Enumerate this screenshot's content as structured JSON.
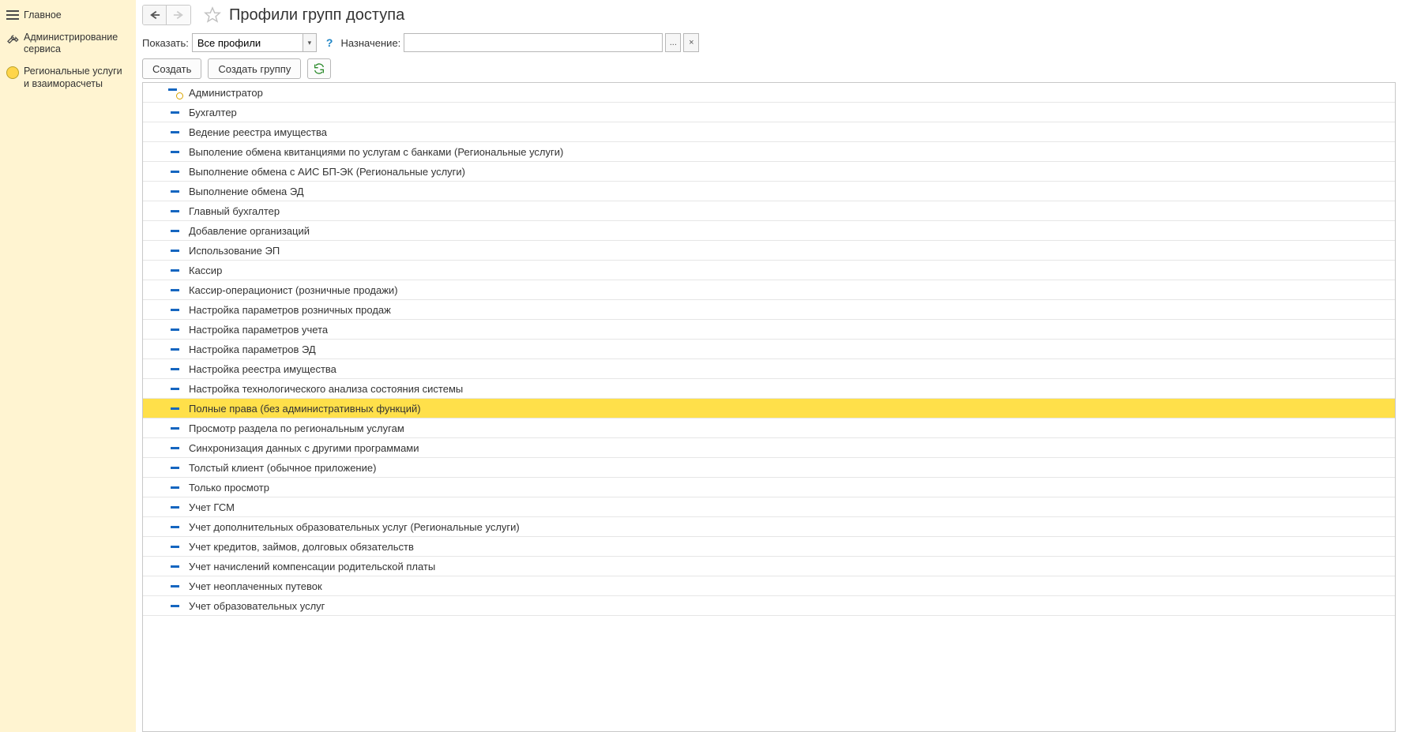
{
  "sidebar": {
    "items": [
      {
        "label": "Главное",
        "icon": "menu"
      },
      {
        "label": "Администрирование сервиса",
        "icon": "wrench"
      },
      {
        "label": "Региональные услуги и взаиморасчеты",
        "icon": "circle"
      }
    ]
  },
  "header": {
    "title": "Профили групп доступа"
  },
  "filter": {
    "show_label": "Показать:",
    "show_value": "Все профили",
    "destination_label": "Назначение:",
    "destination_value": "",
    "more_button": "...",
    "clear_button": "×"
  },
  "toolbar": {
    "create_label": "Создать",
    "create_group_label": "Создать группу"
  },
  "grid": {
    "rows": [
      {
        "label": "Администратор",
        "icon": "admin",
        "selected": false
      },
      {
        "label": "Бухгалтер",
        "icon": "dash",
        "selected": false
      },
      {
        "label": "Ведение реестра имущества",
        "icon": "dash",
        "selected": false
      },
      {
        "label": "Выполение обмена квитанциями по услугам с банками (Региональные услуги)",
        "icon": "dash",
        "selected": false
      },
      {
        "label": "Выполнение обмена с АИС БП-ЭК (Региональные услуги)",
        "icon": "dash",
        "selected": false
      },
      {
        "label": "Выполнение обмена ЭД",
        "icon": "dash",
        "selected": false
      },
      {
        "label": "Главный бухгалтер",
        "icon": "dash",
        "selected": false
      },
      {
        "label": "Добавление организаций",
        "icon": "dash",
        "selected": false
      },
      {
        "label": "Использование ЭП",
        "icon": "dash",
        "selected": false
      },
      {
        "label": "Кассир",
        "icon": "dash",
        "selected": false
      },
      {
        "label": "Кассир-операционист (розничные продажи)",
        "icon": "dash",
        "selected": false
      },
      {
        "label": "Настройка параметров розничных продаж",
        "icon": "dash",
        "selected": false
      },
      {
        "label": "Настройка параметров учета",
        "icon": "dash",
        "selected": false
      },
      {
        "label": "Настройка параметров ЭД",
        "icon": "dash",
        "selected": false
      },
      {
        "label": "Настройка реестра имущества",
        "icon": "dash",
        "selected": false
      },
      {
        "label": "Настройка технологического анализа состояния системы",
        "icon": "dash",
        "selected": false
      },
      {
        "label": "Полные права (без административных функций)",
        "icon": "dash",
        "selected": true
      },
      {
        "label": "Просмотр раздела по региональным услугам",
        "icon": "dash",
        "selected": false
      },
      {
        "label": "Синхронизация данных с другими программами",
        "icon": "dash",
        "selected": false
      },
      {
        "label": "Толстый клиент (обычное приложение)",
        "icon": "dash",
        "selected": false
      },
      {
        "label": "Только просмотр",
        "icon": "dash",
        "selected": false
      },
      {
        "label": "Учет ГСМ",
        "icon": "dash",
        "selected": false
      },
      {
        "label": "Учет дополнительных образовательных услуг (Региональные услуги)",
        "icon": "dash",
        "selected": false
      },
      {
        "label": "Учет кредитов, займов, долговых обязательств",
        "icon": "dash",
        "selected": false
      },
      {
        "label": "Учет начислений компенсации родительской платы",
        "icon": "dash",
        "selected": false
      },
      {
        "label": "Учет неоплаченных путевок",
        "icon": "dash",
        "selected": false
      },
      {
        "label": "Учет образовательных услуг",
        "icon": "dash",
        "selected": false
      }
    ]
  }
}
